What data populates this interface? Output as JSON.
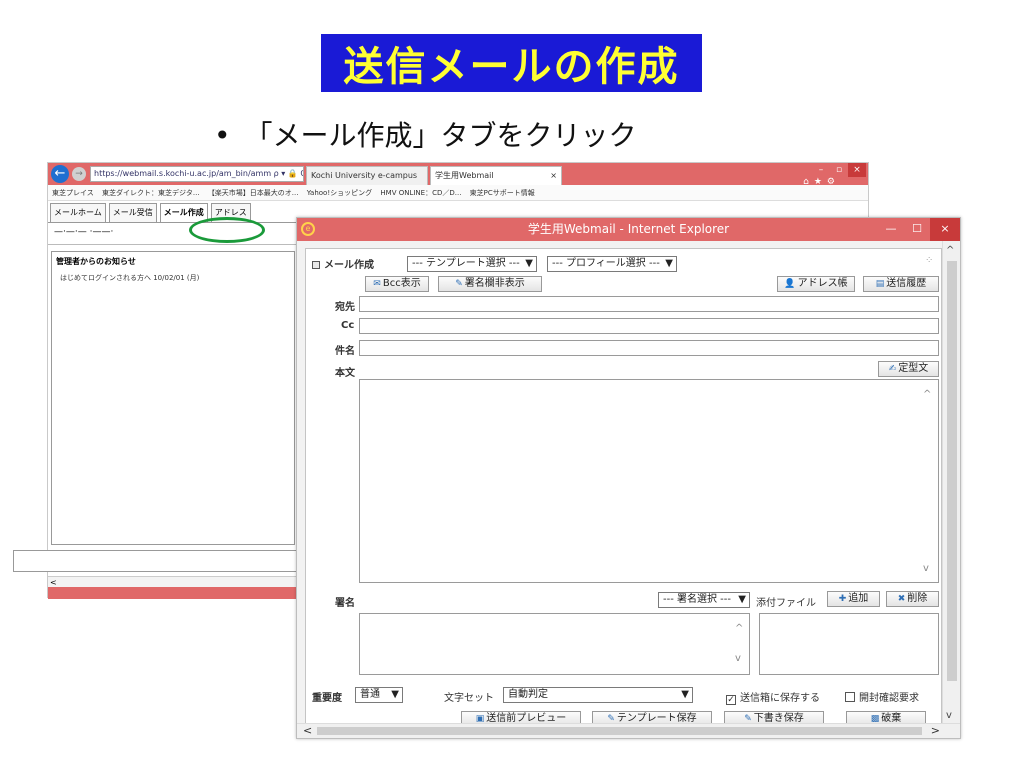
{
  "slide": {
    "title": "送信メールの作成",
    "bullet": "「メール作成」タブをクリック",
    "bullet_marker": "•"
  },
  "background_browser": {
    "address": "https://webmail.s.kochi-u.ac.jp/am_bin/amm ρ ▾ 🔒 C",
    "tabs": [
      "Kochi University e-campus",
      "学生用Webmail"
    ],
    "favorites": [
      "東芝プレイス",
      "東芝ダイレクト：東芝デジタ...",
      "【楽天市場】日本最大のオ...",
      "Yahoo!ショッピング",
      "HMV ONLINE：CD／D...",
      "東芝PCサポート情報"
    ],
    "app_tabs": [
      "メールホーム",
      "メール受信",
      "メール作成",
      "アドレス"
    ],
    "user_name": "—·—·— ·——·",
    "notice_header": "管理者からのお知らせ",
    "notice_item": "はじめてログインされる方へ 10/02/01 (月)"
  },
  "compose_window": {
    "title": "学生用Webmail - Internet Explorer",
    "minimize": "—",
    "maximize": "☐",
    "close": "×",
    "section_label": "メール作成",
    "template_select": "--- テンプレート選択 ---",
    "profile_select": "--- プロフィール選択 ---",
    "bcc_button": "Bcc表示",
    "signature_toggle_button": "署名欄非表示",
    "address_book_button": "アドレス帳",
    "history_button": "送信履歴",
    "to_label": "宛先",
    "to_value": "",
    "cc_label": "Cc",
    "cc_value": "",
    "subject_label": "件名",
    "subject_value": "",
    "body_label": "本文",
    "body_value": "",
    "template_text_button": "定型文",
    "signature_label": "署名",
    "signature_select": "--- 署名選択 ---",
    "attachment_label": "添付ファイル",
    "add_button": "追加",
    "delete_button": "削除",
    "priority_label": "重要度",
    "priority_value": "普通",
    "charset_label": "文字セット",
    "charset_value": "自動判定",
    "save_sent_label": "送信箱に保存する",
    "save_sent_checked": true,
    "read_receipt_label": "開封確認要求",
    "read_receipt_checked": false,
    "preview_button": "送信前プレビュー",
    "template_save_button": "テンプレート保存",
    "draft_save_button": "下書き保存",
    "discard_button": "破棄"
  },
  "colors": {
    "title_bg": "#1a1ad6",
    "title_fg": "#ffff33",
    "window_titlebar": "#e06868",
    "highlight": "#1a9a3a"
  }
}
